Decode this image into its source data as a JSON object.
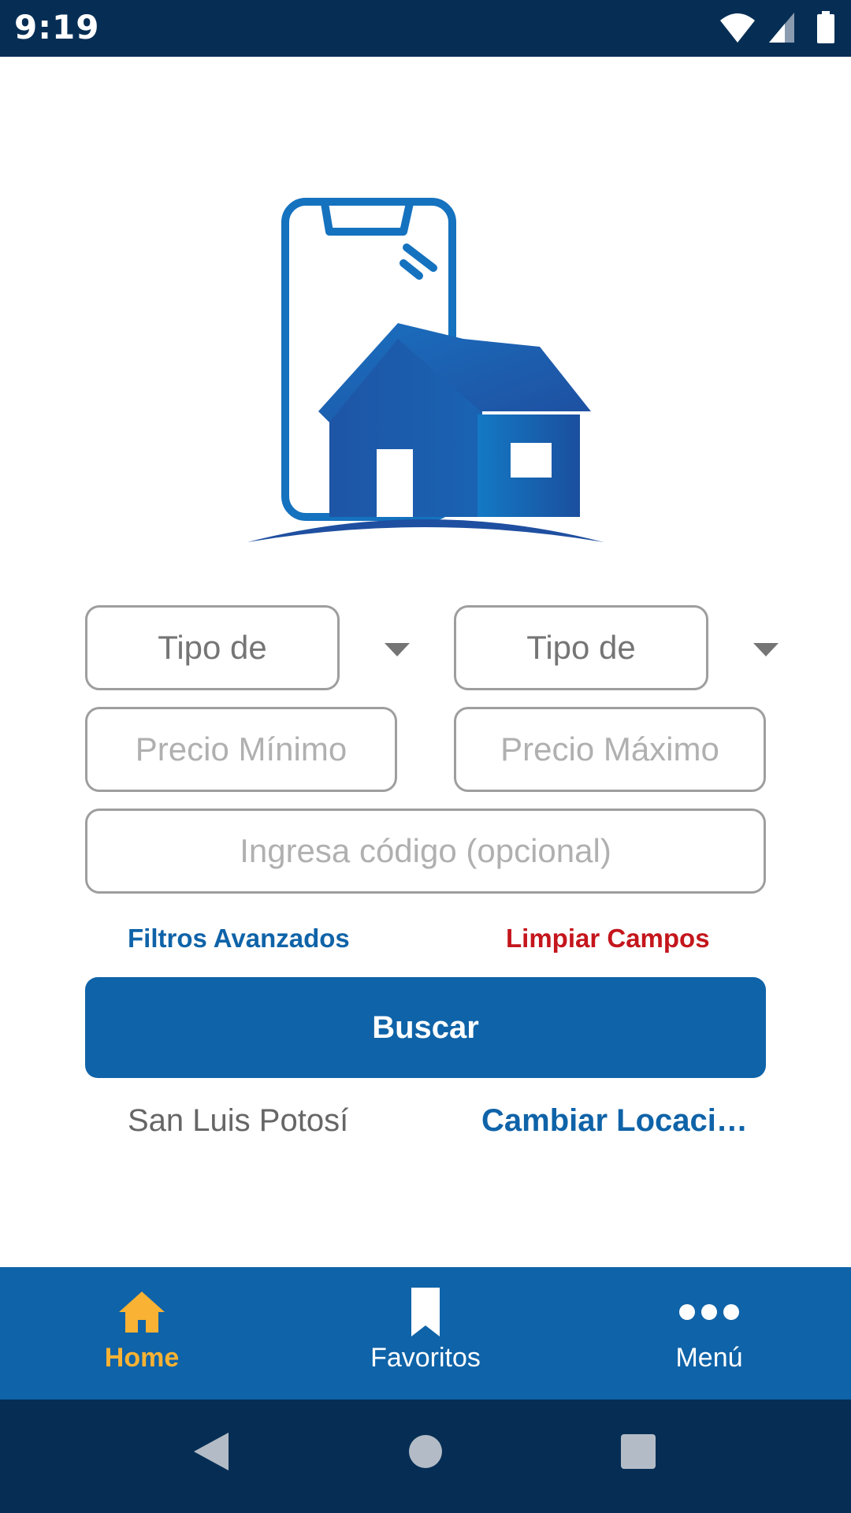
{
  "status_bar": {
    "time": "9:19"
  },
  "form": {
    "property_type_placeholder": "Tipo de",
    "operation_type_placeholder": "Tipo de",
    "min_price_placeholder": "Precio Mínimo",
    "max_price_placeholder": "Precio Máximo",
    "code_placeholder": "Ingresa código (opcional)",
    "advanced_filters_label": "Filtros Avanzados",
    "clear_fields_label": "Limpiar Campos",
    "search_button_label": "Buscar"
  },
  "location": {
    "current": "San Luis Potosí",
    "change_label": "Cambiar Locaci…"
  },
  "bottom_nav": {
    "items": [
      {
        "label": "Home",
        "icon": "home-icon",
        "active": true
      },
      {
        "label": "Favoritos",
        "icon": "bookmark-icon",
        "active": false
      },
      {
        "label": "Menú",
        "icon": "more-dots-icon",
        "active": false
      }
    ]
  },
  "colors": {
    "primary": "#0f63a8",
    "status_bar": "#062e55",
    "active_tab": "#f9b233",
    "clear_link": "#c4161c"
  }
}
